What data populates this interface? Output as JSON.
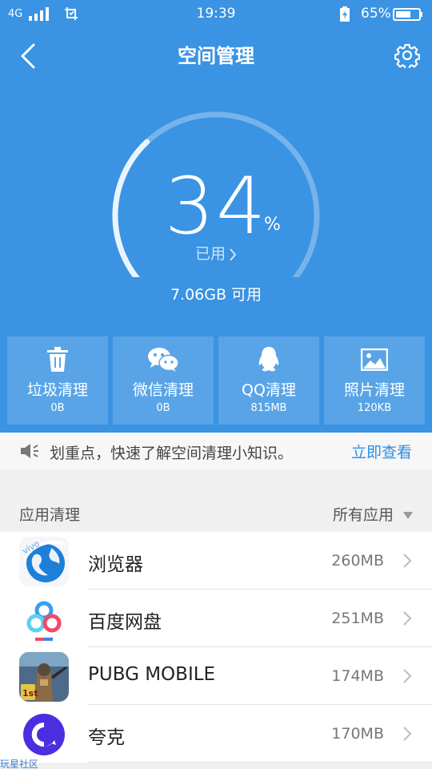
{
  "status_bar": {
    "network": "4G",
    "time": "19:39",
    "battery_percent": "65%"
  },
  "header": {
    "title": "空间管理",
    "back_icon": "chevron-left-icon",
    "settings_icon": "gear-icon"
  },
  "gauge": {
    "value": "34",
    "unit": "%",
    "used_label": "已用",
    "used_fraction": 0.34,
    "available": "7.06GB 可用"
  },
  "tiles": [
    {
      "label": "垃圾清理",
      "size": "0B",
      "icon": "trash-icon"
    },
    {
      "label": "微信清理",
      "size": "0B",
      "icon": "wechat-icon"
    },
    {
      "label": "QQ清理",
      "size": "815MB",
      "icon": "qq-penguin-icon"
    },
    {
      "label": "照片清理",
      "size": "120KB",
      "icon": "image-icon"
    }
  ],
  "tip": {
    "text": "划重点，快速了解空间清理小知识。",
    "link": "立即查看",
    "icon": "speaker-icon"
  },
  "apps_section": {
    "title": "应用清理",
    "filter": "所有应用"
  },
  "apps": [
    {
      "name": "浏览器",
      "size": "260MB",
      "icon": "vivo-browser-icon",
      "badge": "vivo"
    },
    {
      "name": "百度网盘",
      "size": "251MB",
      "icon": "baidu-netdisk-icon"
    },
    {
      "name": "PUBG MOBILE",
      "size": "174MB",
      "icon": "pubg-mobile-icon",
      "badge": "1st"
    },
    {
      "name": "夸克",
      "size": "170MB",
      "icon": "quark-icon"
    }
  ],
  "watermark": "玩星社区",
  "colors": {
    "primary_blue": "#3a93e3",
    "link_blue": "#2a8ee8"
  }
}
